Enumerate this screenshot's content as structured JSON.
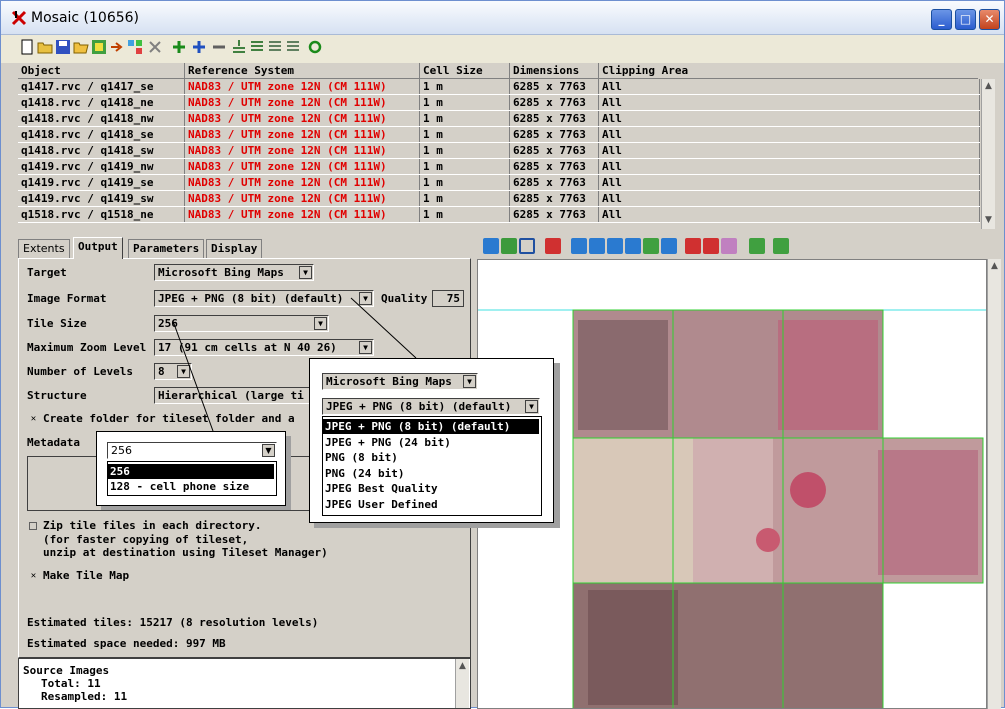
{
  "window": {
    "title": "Mosaic (10656)",
    "min": "_",
    "max": "□",
    "close": "✕"
  },
  "toolbar": {
    "icons": [
      "new-icon",
      "open-icon",
      "save-icon",
      "open-folder-icon",
      "wizard-icon",
      "arrow-icon",
      "grid-icon",
      "remove-icon",
      "add-icon",
      "add2-icon",
      "minus-icon",
      "move-up-icon",
      "move-down-icon",
      "move-top-icon",
      "move-bottom-icon",
      "refresh-icon"
    ]
  },
  "table": {
    "headers": [
      "Object",
      "Reference System",
      "Cell Size",
      "Dimensions",
      "Clipping Area"
    ],
    "rows": [
      [
        "q1417.rvc / q1417_se",
        "NAD83 / UTM zone 12N (CM 111W)",
        "1 m",
        "6285 x 7763",
        "All"
      ],
      [
        "q1418.rvc / q1418_ne",
        "NAD83 / UTM zone 12N (CM 111W)",
        "1 m",
        "6285 x 7763",
        "All"
      ],
      [
        "q1418.rvc / q1418_nw",
        "NAD83 / UTM zone 12N (CM 111W)",
        "1 m",
        "6285 x 7763",
        "All"
      ],
      [
        "q1418.rvc / q1418_se",
        "NAD83 / UTM zone 12N (CM 111W)",
        "1 m",
        "6285 x 7763",
        "All"
      ],
      [
        "q1418.rvc / q1418_sw",
        "NAD83 / UTM zone 12N (CM 111W)",
        "1 m",
        "6285 x 7763",
        "All"
      ],
      [
        "q1419.rvc / q1419_nw",
        "NAD83 / UTM zone 12N (CM 111W)",
        "1 m",
        "6285 x 7763",
        "All"
      ],
      [
        "q1419.rvc / q1419_se",
        "NAD83 / UTM zone 12N (CM 111W)",
        "1 m",
        "6285 x 7763",
        "All"
      ],
      [
        "q1419.rvc / q1419_sw",
        "NAD83 / UTM zone 12N (CM 111W)",
        "1 m",
        "6285 x 7763",
        "All"
      ],
      [
        "q1518.rvc / q1518_ne",
        "NAD83 / UTM zone 12N (CM 111W)",
        "1 m",
        "6285 x 7763",
        "All"
      ]
    ]
  },
  "tabs": [
    "Extents",
    "Output",
    "Parameters",
    "Display"
  ],
  "output": {
    "target_label": "Target",
    "target_value": "Microsoft Bing Maps",
    "format_label": "Image Format",
    "format_value": "JPEG + PNG (8 bit) (default)",
    "quality_label": "Quality",
    "quality_value": "75",
    "tile_size_label": "Tile Size",
    "tile_size_value": "256",
    "max_zoom_label": "Maximum Zoom Level",
    "max_zoom_value": "17 (91 cm cells at N 40 26)",
    "levels_label": "Number of Levels",
    "levels_value": "8",
    "structure_label": "Structure",
    "structure_value": "Hierarchical (large ti",
    "create_folder_label": "Create folder for tileset folder and a",
    "metadata_label": "Metadata",
    "zip_label": "Zip tile files in each directory.",
    "zip_note1": "(for faster copying of tileset,",
    "zip_note2": "unzip at destination using Tileset Manager)",
    "tilemap_label": "Make Tile Map",
    "est_tiles": "Estimated tiles: 15217 (8 resolution levels)",
    "est_space": "Estimated space needed: 997 MB"
  },
  "source": {
    "title": "Source Images",
    "total": "Total: 11",
    "resampled": "Resampled: 11"
  },
  "callout_format": {
    "target_value": "Microsoft Bing Maps",
    "format_value": "JPEG + PNG (8 bit) (default)",
    "options": [
      "JPEG + PNG (8 bit) (default)",
      "JPEG + PNG (24 bit)",
      "PNG (8 bit)",
      "PNG (24 bit)",
      "JPEG Best Quality",
      "JPEG User Defined"
    ],
    "selected": 0
  },
  "callout_tile": {
    "value": "256",
    "options": [
      "256",
      "128 - cell phone size"
    ],
    "selected": 0
  },
  "checks": {
    "create_folder": "✕",
    "tile_map": "✕"
  }
}
